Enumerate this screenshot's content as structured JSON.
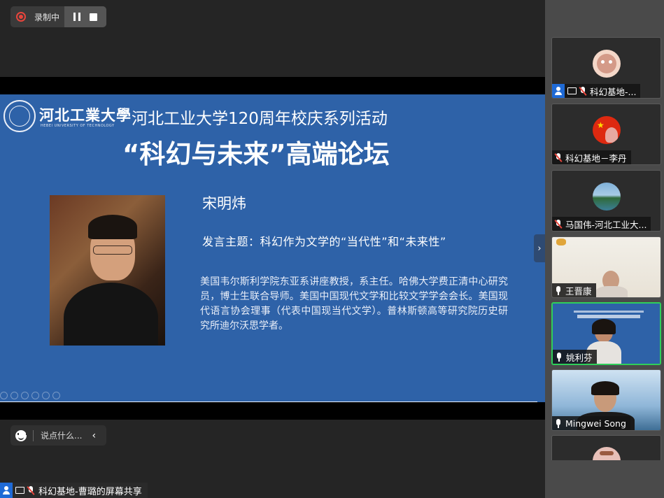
{
  "recording": {
    "label": "录制中"
  },
  "slide": {
    "school_name": "河北工業大學",
    "school_name_en": "HEBEI UNIVERSITY OF TECHNOLOGY",
    "title_line1": "河北工业大学120周年校庆系列活动",
    "title_line2": "“科幻与未来”高端论坛",
    "speaker_name": "宋明炜",
    "topic": "发言主题：科幻作为文学的“当代性”和“未来性”",
    "bio": "美国韦尔斯利学院东亚系讲座教授，系主任。哈佛大学费正清中心研究员，博士生联合导师。美国中国现代文学和比较文学学会会长。美国现代语言协会理事（代表中国现当代文学）。普林斯顿高等研究院历史研究所迪尔沃思学者。"
  },
  "chat": {
    "placeholder": "说点什么..."
  },
  "share": {
    "label": "科幻基地-曹璐的屏幕共享"
  },
  "participants": [
    {
      "name": "科幻基地-...",
      "avatar": "cartoon-avatar",
      "host": true
    },
    {
      "name": "科幻基地－李丹",
      "avatar": "flag-avatar"
    },
    {
      "name": "马国伟-河北工业大...",
      "avatar": "landscape-avatar"
    },
    {
      "name": "王晋康",
      "video": true
    },
    {
      "name": "姚利芬",
      "video": true,
      "speaking": true
    },
    {
      "name": "Mingwei Song",
      "video": true
    },
    {
      "name": "",
      "avatar": "partial-avatar"
    }
  ],
  "colors": {
    "slide_bg": "#2e62a8",
    "active_border": "#2fcf5a",
    "record_red": "#e8453c",
    "host_badge": "#1f6ad6"
  }
}
